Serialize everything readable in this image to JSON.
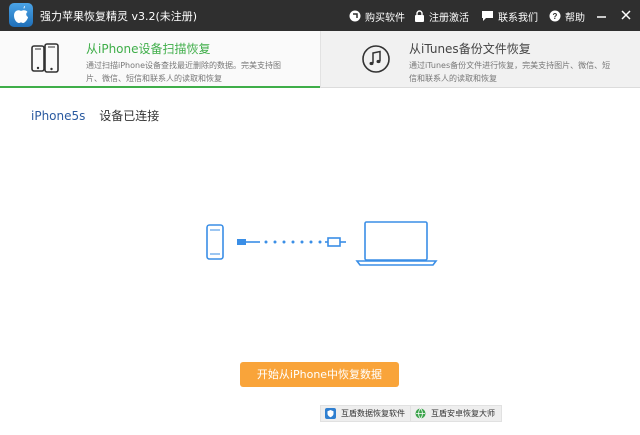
{
  "titlebar": {
    "title": "强力苹果恢复精灵 v3.2(未注册)",
    "menu": {
      "buy": "购买软件",
      "register": "注册激活",
      "contact": "联系我们",
      "help": "帮助"
    }
  },
  "modes": [
    {
      "title": "从iPhone设备扫描恢复",
      "description": "通过扫描iPhone设备查找最近删除的数据。完美支持图片、微信、短信和联系人的读取和恢复",
      "icon": "iphone-pair-icon",
      "selected": true
    },
    {
      "title": "从iTunes备份文件恢复",
      "description": "通过iTunes备份文件进行恢复，完美支持图片、微信、短信和联系人的读取和恢复",
      "icon": "itunes-music-icon",
      "selected": false
    }
  ],
  "device": {
    "name": "iPhone5s",
    "status": "设备已连接"
  },
  "start_button": "开始从iPhone中恢复数据",
  "footer_links": [
    {
      "label": "互盾数据恢复软件",
      "icon": "shield-icon"
    },
    {
      "label": "互盾安卓恢复大师",
      "icon": "globe-icon"
    }
  ],
  "colors": {
    "titlebar": "#2f2f2f",
    "accent_green": "#3fae49",
    "start_button": "#f9a43a",
    "illustration_blue": "#3a8ee6"
  }
}
